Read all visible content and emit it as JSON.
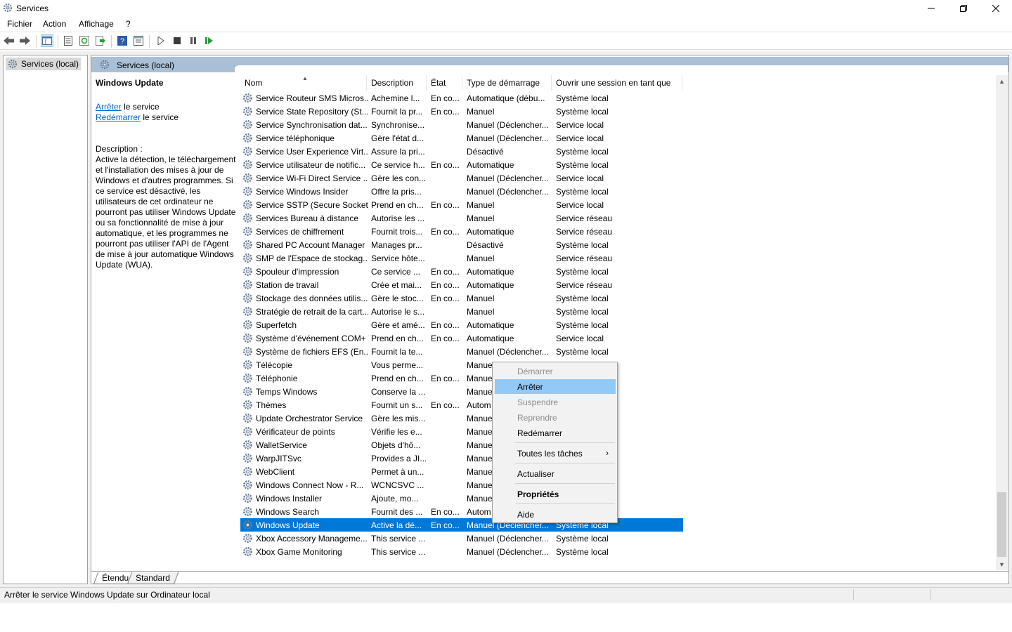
{
  "window": {
    "title": "Services",
    "icon": "gear-icon",
    "minimize": "—",
    "restore": "❐",
    "close": "✕"
  },
  "menu": [
    "Fichier",
    "Action",
    "Affichage",
    "?"
  ],
  "toolbar_icons": [
    "back-arrow-icon",
    "forward-arrow-icon",
    "console-tree-icon",
    "properties-icon",
    "refresh-icon",
    "export-icon",
    "help-icon",
    "view-icon",
    "play-icon",
    "stop-icon",
    "pause-icon",
    "restart-icon"
  ],
  "tree": {
    "root_label": "Services (local)"
  },
  "content": {
    "header_title": "Services (local)",
    "info": {
      "service_name": "Windows Update",
      "stop_link": "Arrêter",
      "stop_suffix": " le service",
      "restart_link": "Redémarrer",
      "restart_suffix": " le service",
      "description_label": "Description :",
      "description": "Active la détection, le téléchargement et l'installation des mises à jour de Windows et d'autres programmes. Si ce service est désactivé, les utilisateurs de cet ordinateur ne pourront pas utiliser Windows Update ou sa fonctionnalité de mise à jour automatique, et les programmes ne pourront pas utiliser l'API de l'Agent de mise à jour automatique Windows Update (WUA)."
    },
    "columns": {
      "name": "Nom",
      "description": "Description",
      "state": "État",
      "startup": "Type de démarrage",
      "logon": "Ouvrir une session en tant que"
    },
    "rows": [
      {
        "name": "Service Routeur SMS Micros...",
        "desc": "Achemine l...",
        "state": "En co...",
        "startup": "Automatique (débu...",
        "logon": "Système local"
      },
      {
        "name": "Service State Repository (St...",
        "desc": "Fournit la pr...",
        "state": "En co...",
        "startup": "Manuel",
        "logon": "Système local"
      },
      {
        "name": "Service Synchronisation dat...",
        "desc": "Synchronise...",
        "state": "",
        "startup": "Manuel (Déclencher...",
        "logon": "Service local"
      },
      {
        "name": "Service téléphonique",
        "desc": "Gère l'état d...",
        "state": "",
        "startup": "Manuel (Déclencher...",
        "logon": "Service local"
      },
      {
        "name": "Service User Experience Virt...",
        "desc": "Assure la pri...",
        "state": "",
        "startup": "Désactivé",
        "logon": "Système local"
      },
      {
        "name": "Service utilisateur de notific...",
        "desc": "Ce service h...",
        "state": "En co...",
        "startup": "Automatique",
        "logon": "Système local"
      },
      {
        "name": "Service Wi-Fi Direct Service ...",
        "desc": "Gère les con...",
        "state": "",
        "startup": "Manuel (Déclencher...",
        "logon": "Service local"
      },
      {
        "name": "Service Windows Insider",
        "desc": "Offre la pris...",
        "state": "",
        "startup": "Manuel (Déclencher...",
        "logon": "Système local"
      },
      {
        "name": "Service SSTP (Secure Socket...",
        "desc": "Prend en ch...",
        "state": "En co...",
        "startup": "Manuel",
        "logon": "Service local"
      },
      {
        "name": "Services Bureau à distance",
        "desc": "Autorise les ...",
        "state": "",
        "startup": "Manuel",
        "logon": "Service réseau"
      },
      {
        "name": "Services de chiffrement",
        "desc": "Fournit trois...",
        "state": "En co...",
        "startup": "Automatique",
        "logon": "Service réseau"
      },
      {
        "name": "Shared PC Account Manager",
        "desc": "Manages pr...",
        "state": "",
        "startup": "Désactivé",
        "logon": "Système local"
      },
      {
        "name": "SMP de l'Espace de stockag...",
        "desc": "Service hôte...",
        "state": "",
        "startup": "Manuel",
        "logon": "Service réseau"
      },
      {
        "name": "Spouleur d'impression",
        "desc": "Ce service ...",
        "state": "En co...",
        "startup": "Automatique",
        "logon": "Système local"
      },
      {
        "name": "Station de travail",
        "desc": "Crée et mai...",
        "state": "En co...",
        "startup": "Automatique",
        "logon": "Service réseau"
      },
      {
        "name": "Stockage des données utilis...",
        "desc": "Gère le stoc...",
        "state": "En co...",
        "startup": "Manuel",
        "logon": "Système local"
      },
      {
        "name": "Stratégie de retrait de la cart...",
        "desc": "Autorise le s...",
        "state": "",
        "startup": "Manuel",
        "logon": "Système local"
      },
      {
        "name": "Superfetch",
        "desc": "Gère et amé...",
        "state": "En co...",
        "startup": "Automatique",
        "logon": "Système local"
      },
      {
        "name": "Système d'événement COM+",
        "desc": "Prend en ch...",
        "state": "En co...",
        "startup": "Automatique",
        "logon": "Service local"
      },
      {
        "name": "Système de fichiers EFS (En...",
        "desc": "Fournit la te...",
        "state": "",
        "startup": "Manuel (Déclencher...",
        "logon": "Système local"
      },
      {
        "name": "Télécopie",
        "desc": "Vous perme...",
        "state": "",
        "startup": "Manuel",
        "logon": ""
      },
      {
        "name": "Téléphonie",
        "desc": "Prend en ch...",
        "state": "En co...",
        "startup": "Manuel",
        "logon": ""
      },
      {
        "name": "Temps Windows",
        "desc": "Conserve la ...",
        "state": "",
        "startup": "Manuel",
        "logon": ""
      },
      {
        "name": "Thèmes",
        "desc": "Fournit un s...",
        "state": "En co...",
        "startup": "Autom",
        "logon": ""
      },
      {
        "name": "Update Orchestrator Service",
        "desc": "Gère les mis...",
        "state": "",
        "startup": "Manuel",
        "logon": ""
      },
      {
        "name": "Vérificateur de points",
        "desc": "Vérifie les e...",
        "state": "",
        "startup": "Manuel",
        "logon": ""
      },
      {
        "name": "WalletService",
        "desc": "Objets d'hô...",
        "state": "",
        "startup": "Manuel",
        "logon": ""
      },
      {
        "name": "WarpJITSvc",
        "desc": "Provides a JI...",
        "state": "",
        "startup": "Manuel",
        "logon": ""
      },
      {
        "name": "WebClient",
        "desc": "Permet à un...",
        "state": "",
        "startup": "Manuel",
        "logon": ""
      },
      {
        "name": "Windows Connect Now - R...",
        "desc": "WCNCSVC ...",
        "state": "",
        "startup": "Manuel",
        "logon": ""
      },
      {
        "name": "Windows Installer",
        "desc": "Ajoute, mo...",
        "state": "",
        "startup": "Manuel",
        "logon": ""
      },
      {
        "name": "Windows Search",
        "desc": "Fournit des ...",
        "state": "En co...",
        "startup": "Autom",
        "logon": ""
      },
      {
        "name": "Windows Update",
        "desc": "Active la dé...",
        "state": "En co...",
        "startup": "Manuel (Déclencher...",
        "logon": "Système local",
        "selected": true
      },
      {
        "name": "Xbox Accessory Manageme...",
        "desc": "This service ...",
        "state": "",
        "startup": "Manuel (Déclencher...",
        "logon": "Système local"
      },
      {
        "name": "Xbox Game Monitoring",
        "desc": "This service ...",
        "state": "",
        "startup": "Manuel (Déclencher...",
        "logon": "Système local"
      }
    ],
    "tabs": [
      "Étendu",
      "Standard"
    ]
  },
  "context_menu": {
    "start": "Démarrer",
    "stop": "Arrêter",
    "pause": "Suspendre",
    "resume": "Reprendre",
    "restart": "Redémarrer",
    "all_tasks": "Toutes les tâches",
    "refresh": "Actualiser",
    "properties": "Propriétés",
    "help": "Aide",
    "submenu_arrow": "›"
  },
  "statusbar": {
    "text": "Arrêter le service Windows Update sur Ordinateur local"
  },
  "colors": {
    "selection": "#0078d7",
    "menu_hover": "#91c9f7",
    "header_band": "#a8bfd6",
    "link": "#0066cc"
  }
}
